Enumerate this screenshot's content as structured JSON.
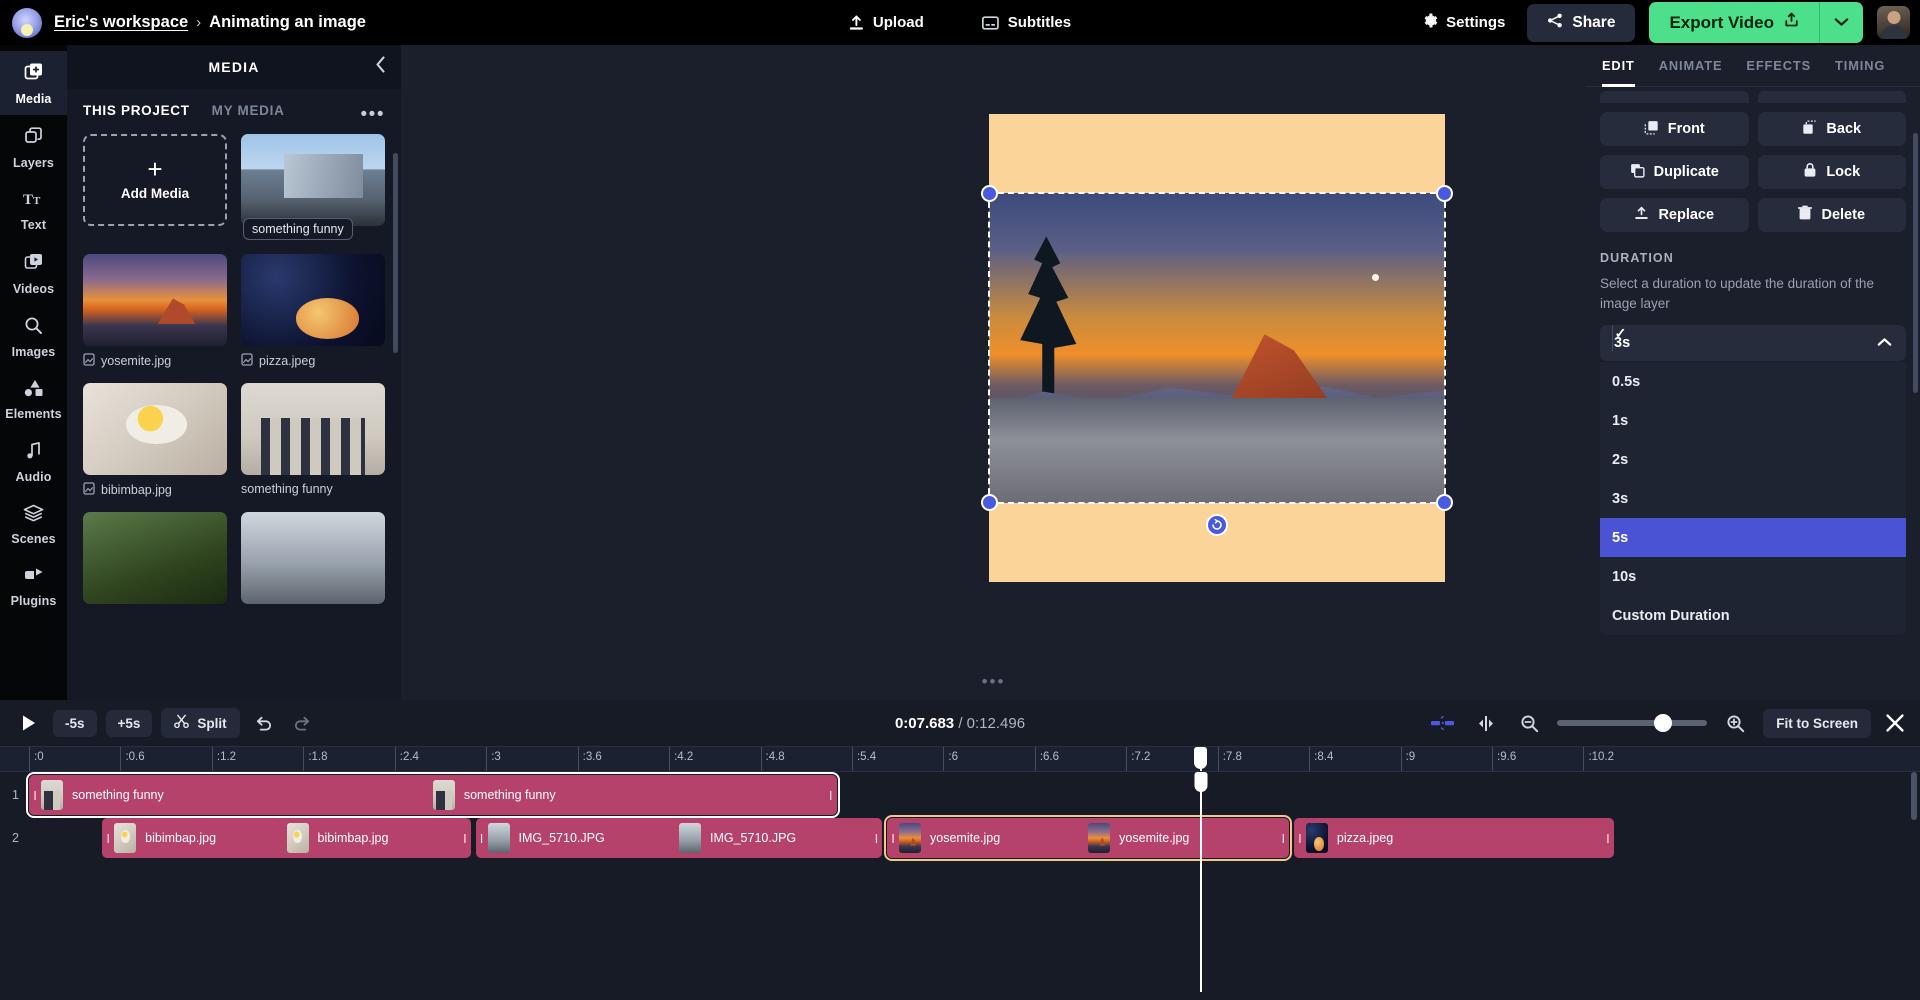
{
  "topbar": {
    "workspace": "Eric's workspace",
    "separator": "›",
    "project_title": "Animating an image",
    "upload_label": "Upload",
    "subtitles_label": "Subtitles",
    "settings_label": "Settings",
    "share_label": "Share",
    "export_label": "Export Video",
    "accent_green": "#4ce08a"
  },
  "rail": {
    "items": [
      {
        "label": "Media",
        "icon": "media-icon",
        "active": true
      },
      {
        "label": "Layers",
        "icon": "layers-icon",
        "active": false
      },
      {
        "label": "Text",
        "icon": "text-icon",
        "active": false
      },
      {
        "label": "Videos",
        "icon": "videos-icon",
        "active": false
      },
      {
        "label": "Images",
        "icon": "images-icon",
        "active": false
      },
      {
        "label": "Elements",
        "icon": "elements-icon",
        "active": false
      },
      {
        "label": "Audio",
        "icon": "audio-icon",
        "active": false
      },
      {
        "label": "Scenes",
        "icon": "scenes-icon",
        "active": false
      },
      {
        "label": "Plugins",
        "icon": "plugins-icon",
        "active": false
      }
    ]
  },
  "media_panel": {
    "title": "MEDIA",
    "tabs": [
      {
        "label": "THIS PROJECT",
        "active": true
      },
      {
        "label": "MY MEDIA",
        "active": false
      }
    ],
    "add_media_label": "Add Media",
    "items": [
      {
        "name": "something funny",
        "kind": "chip",
        "thumb": "th-building"
      },
      {
        "name": "yosemite.jpg",
        "kind": "file",
        "thumb": "th-yos"
      },
      {
        "name": "pizza.jpeg",
        "kind": "file",
        "thumb": "th-pizza"
      },
      {
        "name": "bibimbap.jpg",
        "kind": "file",
        "thumb": "th-bibim"
      },
      {
        "name": "something funny",
        "kind": "plain",
        "thumb": "th-group"
      },
      {
        "name": "",
        "kind": "none",
        "thumb": "th-veg"
      },
      {
        "name": "",
        "kind": "none",
        "thumb": "th-door"
      }
    ]
  },
  "right_panel": {
    "tabs": [
      {
        "label": "EDIT",
        "active": true
      },
      {
        "label": "ANIMATE",
        "active": false
      },
      {
        "label": "EFFECTS",
        "active": false
      },
      {
        "label": "TIMING",
        "active": false
      }
    ],
    "buttons": [
      {
        "label": "Front",
        "icon": "bring-front-icon"
      },
      {
        "label": "Back",
        "icon": "send-back-icon"
      },
      {
        "label": "Duplicate",
        "icon": "duplicate-icon"
      },
      {
        "label": "Lock",
        "icon": "lock-icon"
      },
      {
        "label": "Replace",
        "icon": "replace-icon"
      },
      {
        "label": "Delete",
        "icon": "trash-icon"
      }
    ],
    "duration": {
      "section_title": "DURATION",
      "description": "Select a duration to update the duration of the image layer",
      "selected": "3s",
      "options": [
        {
          "label": "0.5s",
          "checked": false,
          "highlight": false
        },
        {
          "label": "1s",
          "checked": false,
          "highlight": false
        },
        {
          "label": "2s",
          "checked": false,
          "highlight": false
        },
        {
          "label": "3s",
          "checked": true,
          "highlight": false
        },
        {
          "label": "5s",
          "checked": false,
          "highlight": true
        },
        {
          "label": "10s",
          "checked": false,
          "highlight": false
        },
        {
          "label": "Custom Duration",
          "checked": false,
          "highlight": false
        }
      ],
      "highlight_color": "#4a53d4"
    }
  },
  "timeline": {
    "minus_5s": "-5s",
    "plus_5s": "+5s",
    "split_label": "Split",
    "current_time": "0:07.683",
    "time_separator": " / ",
    "total_time": "0:12.496",
    "fit_label": "Fit to Screen",
    "zoom_percent": 71,
    "ruler_ticks": [
      ":0",
      ":0.6",
      ":1.2",
      ":1.8",
      ":2.4",
      ":3",
      ":3.6",
      ":4.2",
      ":4.8",
      ":5.4",
      ":6",
      ":6.6",
      ":7.2",
      ":7.8",
      ":8.4",
      ":9",
      ":9.6",
      ":10.2"
    ],
    "playhead_time": 7.683,
    "tracks": [
      {
        "number": "1",
        "clips": [
          {
            "label": "something funny",
            "label2": "something funny",
            "start": 0.0,
            "end": 5.3,
            "thumb": "th-group",
            "selected": false,
            "outlined": true
          }
        ]
      },
      {
        "number": "2",
        "clips": [
          {
            "label": "bibimbap.jpg",
            "label2": "bibimbap.jpg",
            "start": 0.48,
            "end": 2.9,
            "thumb": "th-bibim",
            "selected": false,
            "outlined": false
          },
          {
            "label": "IMG_5710.JPG",
            "label2": "IMG_5710.JPG",
            "start": 2.93,
            "end": 5.6,
            "thumb": "th-door",
            "selected": false,
            "outlined": false
          },
          {
            "label": "yosemite.jpg",
            "label2": "yosemite.jpg",
            "start": 5.63,
            "end": 8.27,
            "thumb": "th-yos",
            "selected": true,
            "outlined": false
          },
          {
            "label": "pizza.jpeg",
            "label2": "",
            "start": 8.3,
            "end": 10.4,
            "thumb": "th-pizza",
            "selected": false,
            "outlined": false
          }
        ]
      }
    ]
  },
  "canvas": {
    "background_color": "#fbd49a",
    "selected_layer": "yosemite.jpg"
  }
}
